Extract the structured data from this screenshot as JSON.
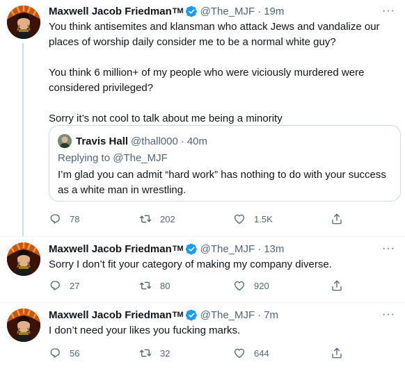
{
  "tweets": [
    {
      "author_name": "Maxwell Jacob Friedman",
      "author_tm": "TM",
      "handle": "@The_MJF",
      "time": "19m",
      "text": "You think antisemites and klansman who attack Jews and vandalize our places of worship daily consider me to be a normal white guy?\n\nYou think 6 million+ of my people who were viciously murdered were considered privileged?\n\nSorry it’s not cool to talk about me being a minority",
      "quote": {
        "author_name": "Travis Hall",
        "handle": "@thall000",
        "time": "40m",
        "replying_prefix": "Replying to",
        "replying_to": "@The_MJF",
        "text": "I’m glad you can admit “hard work” has nothing to do with your success as a white man in wrestling."
      },
      "replies": "78",
      "retweets": "202",
      "likes": "1.5K"
    },
    {
      "author_name": "Maxwell Jacob Friedman",
      "author_tm": "TM",
      "handle": "@The_MJF",
      "time": "13m",
      "text": "Sorry I don’t fit your category of making my company diverse.",
      "replies": "27",
      "retweets": "80",
      "likes": "920"
    },
    {
      "author_name": "Maxwell Jacob Friedman",
      "author_tm": "TM",
      "handle": "@The_MJF",
      "time": "7m",
      "text": "I don’t need your likes you fucking marks.",
      "replies": "56",
      "retweets": "32",
      "likes": "644"
    }
  ],
  "separator": "·",
  "colors": {
    "verified": "#1d9bf0",
    "secondary_text": "#536471",
    "border": "#cfd9de"
  },
  "icons": {
    "reply": "reply-icon",
    "retweet": "retweet-icon",
    "like": "heart-icon",
    "share": "share-icon",
    "more": "more-icon",
    "verified": "verified-badge-icon"
  }
}
